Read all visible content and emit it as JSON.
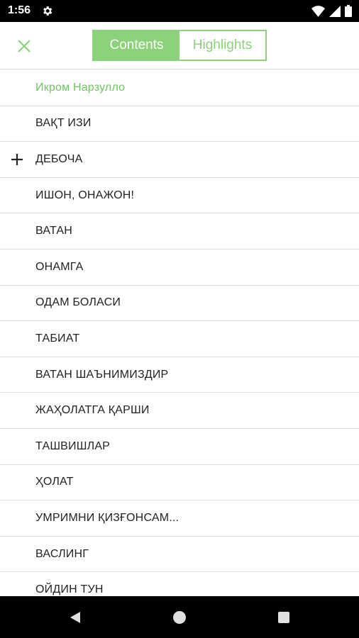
{
  "status_bar": {
    "time": "1:56",
    "icons": [
      "gear-icon",
      "wifi-icon",
      "signal-icon",
      "battery-icon"
    ]
  },
  "header": {
    "close_icon": "close-icon",
    "tabs": [
      {
        "label": "Contents",
        "active": true
      },
      {
        "label": "Highlights",
        "active": false
      }
    ],
    "accent_color": "#8bd27a"
  },
  "toc": {
    "author": "Икром Нарзулло",
    "items": [
      {
        "label": "ВАҚТ ИЗИ"
      },
      {
        "label": "ДЕБОЧА",
        "expandable": true
      },
      {
        "label": "ИШОН, ОНАЖОН!"
      },
      {
        "label": "ВАТАН"
      },
      {
        "label": "ОНАМГА"
      },
      {
        "label": "ОДАМ БОЛАСИ"
      },
      {
        "label": "ТАБИАТ"
      },
      {
        "label": "ВАТАН ШАЪНИМИЗДИР"
      },
      {
        "label": "ЖАҲОЛАТГА ҚАРШИ"
      },
      {
        "label": "ТАШВИШЛАР"
      },
      {
        "label": "ҲОЛАТ"
      },
      {
        "label": "УМРИМНИ ҚИЗҒОНСАМ..."
      },
      {
        "label": "ВАСЛИНГ"
      },
      {
        "label": "ОЙДИН ТУН"
      }
    ]
  },
  "nav_bar": {
    "icons": [
      "back-icon",
      "home-icon",
      "recents-icon"
    ]
  }
}
